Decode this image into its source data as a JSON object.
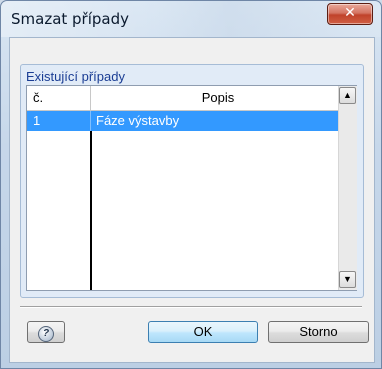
{
  "window": {
    "title": "Smazat případy",
    "close_glyph": "✕"
  },
  "group": {
    "title": "Existující případy"
  },
  "grid": {
    "columns": [
      "č.",
      "Popis"
    ],
    "rows": [
      {
        "no": "1",
        "desc": "Fáze výstavby",
        "selected": true
      }
    ]
  },
  "buttons": {
    "help_icon": "question-icon",
    "ok_label": "OK",
    "cancel_label": "Storno"
  },
  "colors": {
    "selection": "#3399ff",
    "group_title": "#1a3d94"
  }
}
